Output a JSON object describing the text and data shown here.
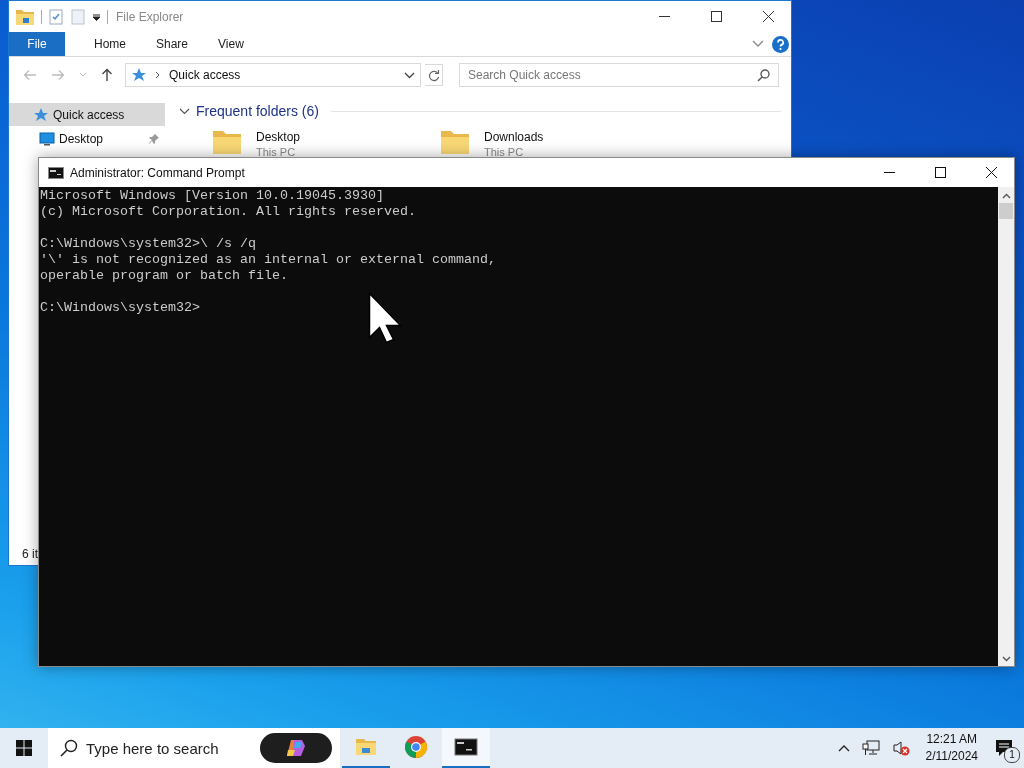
{
  "explorer_window": {
    "title": "File Explorer",
    "ribbon_tabs": [
      {
        "label": "File",
        "kind": "file",
        "selected": false
      },
      {
        "label": "Home",
        "kind": "tab",
        "selected": false
      },
      {
        "label": "Share",
        "kind": "tab",
        "selected": false
      },
      {
        "label": "View",
        "kind": "tab",
        "selected": false
      }
    ],
    "address": {
      "path": "Quick access"
    },
    "search": {
      "placeholder": "Search Quick access"
    },
    "nav_items": [
      {
        "label": "Quick access",
        "kind": "star",
        "selected": true,
        "pinned": false
      },
      {
        "label": "Desktop",
        "kind": "desktop",
        "selected": false,
        "pinned": true
      }
    ],
    "section": {
      "title": "Frequent folders (6)",
      "expanded": true
    },
    "folders": [
      {
        "name": "Desktop",
        "location": "This PC"
      },
      {
        "name": "Downloads",
        "location": "This PC"
      }
    ],
    "status_bar": "6 it"
  },
  "cmd_window": {
    "title": "Administrator: Command Prompt",
    "output_blocks": [
      [
        "Microsoft Windows [Version 10.0.19045.3930]",
        "(c) Microsoft Corporation. All rights reserved."
      ],
      [
        "C:\\Windows\\system32>\\ /s /q",
        "'\\' is not recognized as an internal or external command,",
        "operable program or batch file."
      ],
      [
        "C:\\Windows\\system32>"
      ]
    ]
  },
  "taskbar": {
    "search": {
      "placeholder": "Type here to search"
    },
    "apps": [
      {
        "kind": "explorer",
        "running": true,
        "active": false
      },
      {
        "kind": "chrome",
        "running": false,
        "active": false
      },
      {
        "kind": "terminal",
        "running": true,
        "active": true
      }
    ],
    "tray": {
      "volume_muted": true,
      "time": "12:21 AM",
      "date": "2/11/2024",
      "notification_count": "1"
    }
  }
}
